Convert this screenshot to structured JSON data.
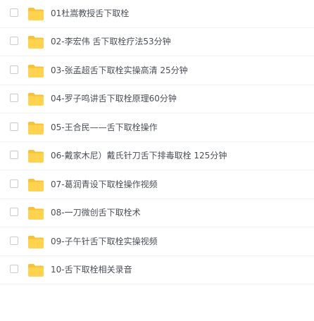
{
  "files": [
    {
      "name": "01杜嵩教授舌下取栓"
    },
    {
      "name": "02-李宏伟 舌下取栓疗法53分钟"
    },
    {
      "name": "03-张孟超舌下取栓实操高清 25分钟"
    },
    {
      "name": "04-罗子鸣讲舌下取栓原理60分钟"
    },
    {
      "name": "05-王合民——舌下取栓操作"
    },
    {
      "name": "06-戴家木尼）戴氏针刀舌下排毒取栓 125分钟"
    },
    {
      "name": "07-葛润青设下取栓操作视频"
    },
    {
      "name": "08-一刀微创舌下取栓术"
    },
    {
      "name": "09-子午针舌下取栓实操视频"
    },
    {
      "name": "10-舌下取栓相关录音"
    }
  ],
  "icons": {
    "checkbox": "checkbox-unchecked",
    "folder": "folder-icon"
  },
  "colors": {
    "folder_body": "#ffd34d",
    "folder_tab": "#f7c236",
    "text": "#4b4f56",
    "divider": "#f0f1f3"
  }
}
